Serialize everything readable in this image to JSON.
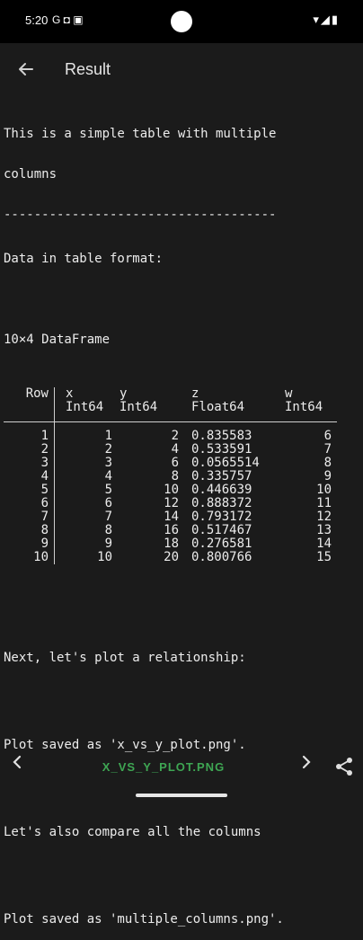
{
  "status": {
    "time": "5:20",
    "left_icons": "G ◘ ▣",
    "right_icons": "▾◢▮"
  },
  "appbar": {
    "title": "Result",
    "back_icon": "arrow-left-icon"
  },
  "output": {
    "line1": "This is a simple table with multiple",
    "line2": "columns",
    "rule": "------------------------------------",
    "data_heading": "Data in table format:",
    "df_title": "10×4 DataFrame",
    "df_headers": [
      "Row",
      "x",
      "y",
      "z",
      "w"
    ],
    "df_types": [
      "",
      "Int64",
      "Int64",
      "Float64",
      "Int64"
    ],
    "df_rows": [
      [
        "1",
        "1",
        "2",
        "0.835583",
        "6"
      ],
      [
        "2",
        "2",
        "4",
        "0.533591",
        "7"
      ],
      [
        "3",
        "3",
        "6",
        "0.0565514",
        "8"
      ],
      [
        "4",
        "4",
        "8",
        "0.335757",
        "9"
      ],
      [
        "5",
        "5",
        "10",
        "0.446639",
        "10"
      ],
      [
        "6",
        "6",
        "12",
        "0.888372",
        "11"
      ],
      [
        "7",
        "7",
        "14",
        "0.793172",
        "12"
      ],
      [
        "8",
        "8",
        "16",
        "0.517467",
        "13"
      ],
      [
        "9",
        "9",
        "18",
        "0.276581",
        "14"
      ],
      [
        "10",
        "10",
        "20",
        "0.800766",
        "15"
      ]
    ],
    "msg1": "Next, let's plot a relationship:",
    "msg2": "Plot saved as 'x_vs_y_plot.png'.",
    "msg3": "Let's also compare all the columns",
    "msg4": "Plot saved as 'multiple_columns.png'."
  },
  "bottombar": {
    "prev_icon": "chevron-left-icon",
    "filename": "X_VS_Y_PLOT.PNG",
    "next_icon": "chevron-right-icon",
    "share_icon": "share-icon"
  },
  "colors": {
    "background": "#1b1b1b",
    "accent": "#3ea653",
    "text": "#ececec"
  }
}
